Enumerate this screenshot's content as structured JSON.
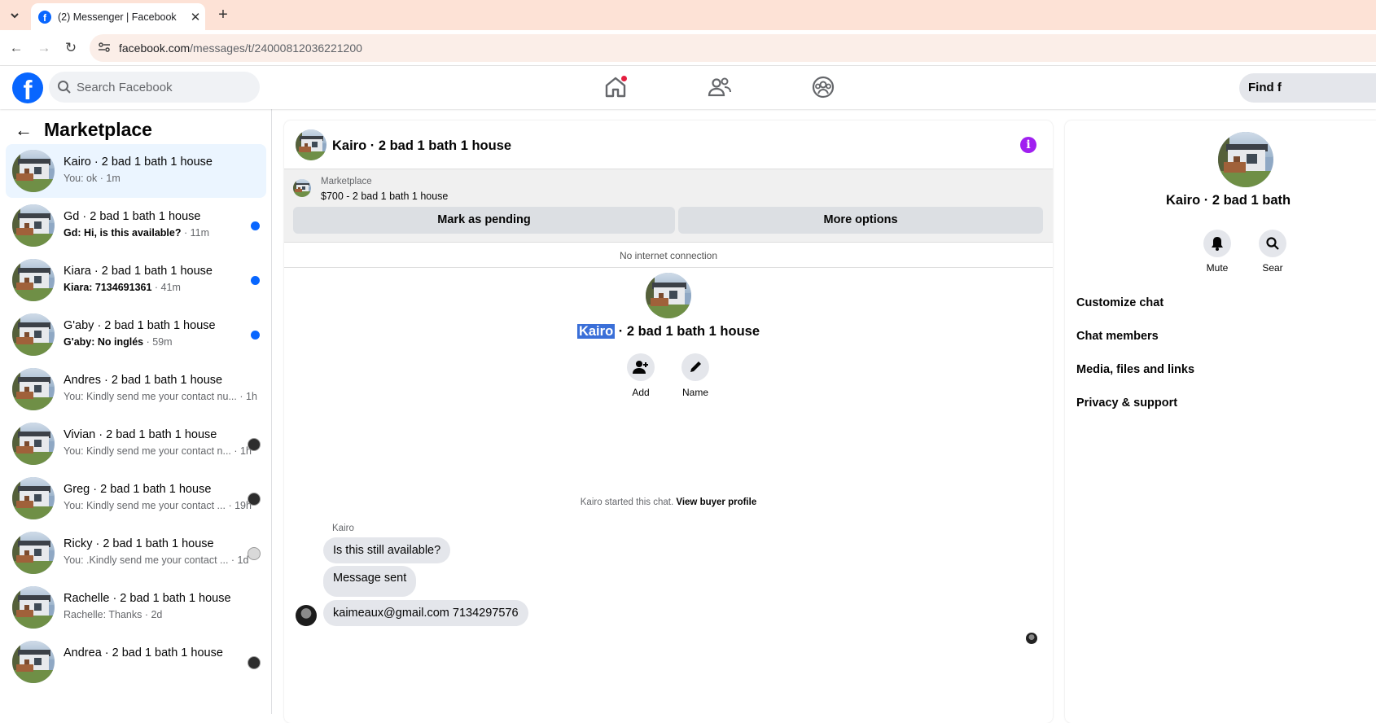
{
  "browser": {
    "tab_title": "(2) Messenger | Facebook",
    "url_host": "facebook.com",
    "url_path": "/messages/t/24000812036221200"
  },
  "header": {
    "search_placeholder": "Search Facebook",
    "find_button": "Find f",
    "home_notification": true
  },
  "sidebar": {
    "title": "Marketplace",
    "conversations": [
      {
        "name": "Kairo · 2 bad 1 bath 1 house",
        "snippet": "You: ok",
        "time": "· 1m",
        "active": true,
        "unread": false
      },
      {
        "name": "Gd · 2 bad 1 bath 1 house",
        "snippet": "Gd: Hi, is this available?",
        "time": "· 11m",
        "unread": true
      },
      {
        "name": "Kiara · 2 bad 1 bath 1 house",
        "snippet": "Kiara: 7134691361",
        "time": "· 41m",
        "unread": true
      },
      {
        "name": "G'aby · 2 bad 1 bath 1 house",
        "snippet": "G'aby: No inglés",
        "time": "· 59m",
        "unread": true
      },
      {
        "name": "Andres · 2 bad 1 bath 1 house",
        "snippet": "You: Kindly send me your contact nu...",
        "time": "· 1h",
        "unread": false
      },
      {
        "name": "Vivian · 2 bad 1 bath 1 house",
        "snippet": "You: Kindly send me your contact n...",
        "time": "· 1h",
        "unread": false,
        "seen": "dark"
      },
      {
        "name": "Greg · 2 bad 1 bath 1 house",
        "snippet": "You: Kindly send me your contact ...",
        "time": "· 19h",
        "unread": false,
        "seen": "dark"
      },
      {
        "name": "Ricky · 2 bad 1 bath 1 house",
        "snippet": "You: .Kindly send me your contact ...",
        "time": "· 1d",
        "unread": false,
        "seen": "grey"
      },
      {
        "name": "Rachelle · 2 bad 1 bath 1 house",
        "snippet": "Rachelle: Thanks",
        "time": "· 2d",
        "unread": false
      },
      {
        "name": "Andrea · 2 bad 1 bath 1 house",
        "snippet": "",
        "time": "",
        "unread": false,
        "seen": "dark"
      }
    ]
  },
  "chat": {
    "title": "Kairo · 2 bad 1 bath 1 house",
    "banner_label": "Marketplace",
    "banner_price": "$700 - 2 bad 1 bath 1 house",
    "mark_pending": "Mark as pending",
    "more_options": "More options",
    "status": "No internet connection",
    "name_highlight": "Kairo",
    "name_rest": " · 2 bad 1 bath 1 house",
    "add_label": "Add",
    "name_label": "Name",
    "started_text": "Kairo started this chat.",
    "view_profile": "View buyer profile",
    "sender": "Kairo",
    "messages": [
      "Is this still available?",
      "Message sent",
      "kaimeaux@gmail.com 7134297576"
    ]
  },
  "right_panel": {
    "name": "Kairo · 2 bad 1 bath",
    "mute": "Mute",
    "search": "Sear",
    "items": [
      "Customize chat",
      "Chat members",
      "Media, files and links",
      "Privacy & support"
    ]
  },
  "colors": {
    "brand": "#0866ff",
    "info": "#a020f0",
    "unread_dot": "#0866ff",
    "highlight": "#3a6fd8"
  }
}
